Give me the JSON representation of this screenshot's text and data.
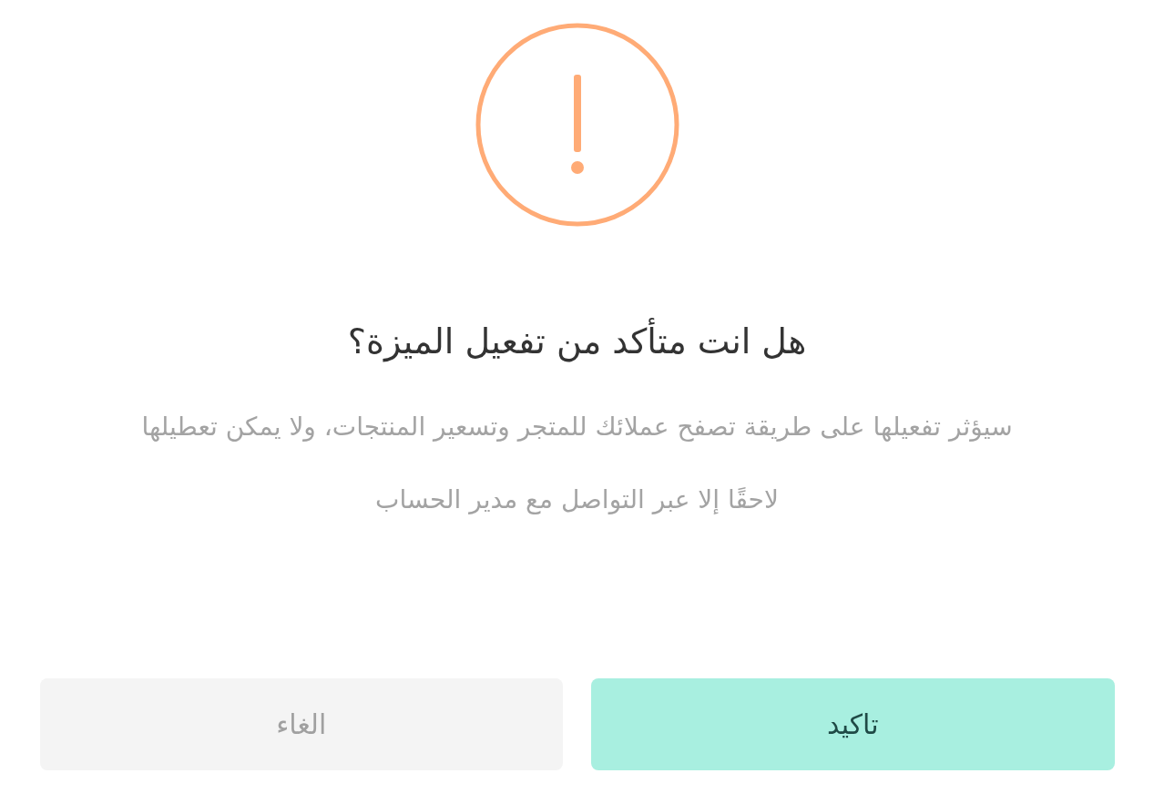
{
  "dialog": {
    "title": "هل انت متأكد من تفعيل الميزة؟",
    "message": "سيؤثر تفعيلها على طريقة تصفح عملائك للمتجر وتسعير المنتجات، ولا يمكن تعطيلها لاحقًا إلا عبر التواصل مع مدير الحساب",
    "buttons": [
      {
        "kind": "confirm",
        "label": "تاكيد"
      },
      {
        "kind": "cancel",
        "label": "الغاء"
      }
    ]
  }
}
